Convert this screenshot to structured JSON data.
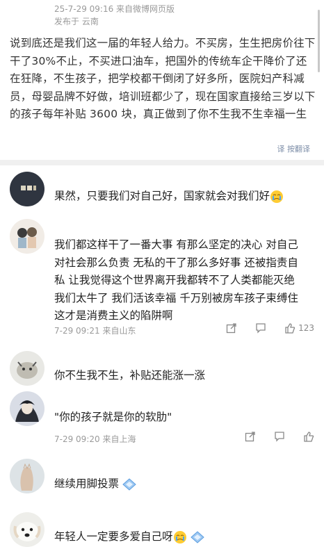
{
  "post": {
    "timestamp_source": "25-7-29 09:16  来自微博网页版",
    "location": "发布于 云南",
    "body": "说到底还是我们这一届的年轻人给力。不买房，生生把房价往下干了30%不止，不买进口油车，把国外的传统车企干降价了还在狂降，不生孩子，把学校都干倒闭了好多所，医院妇产科减员，母婴品牌不好做，培训班都少了，现在国家直接给三岁以下的孩子每年补贴 3600 块，真正做到了你不生我不生幸福一生",
    "translate_label": "译 按翻译"
  },
  "comments": [
    {
      "text": "果然，只要我们对自己好，国家就会对我们好",
      "emoji": "crying-face-icon"
    },
    {
      "lines": [
        "我们都这样干了一番大事 有那么坚定的决心 对自己",
        "对社会那么负责 无私的干了那么多好事 还被指责自",
        "私 让我觉得这个世界离开我都转不了人类都能灭绝",
        "我们太牛了 我们活该幸福 千万别被房车孩子束缚住",
        "这才是消费主义的陷阱啊"
      ],
      "meta": "7-29 09:21 来自山东",
      "like_count": "123"
    },
    {
      "text": "你不生我不生，补贴还能涨一涨"
    },
    {
      "text": "\"你的孩子就是你的软肋\"",
      "meta": "7-29 09:20 来自上海"
    },
    {
      "text": "继续用脚投票",
      "emoji": "diamond-icon"
    },
    {
      "text": "年轻人一定要多爱自己呀",
      "emoji": "crying-face-icon"
    }
  ],
  "colors": {
    "meta": "#9a9a9a",
    "divider": "#f0f0f0",
    "accent_blue": "#7d8ea8"
  }
}
